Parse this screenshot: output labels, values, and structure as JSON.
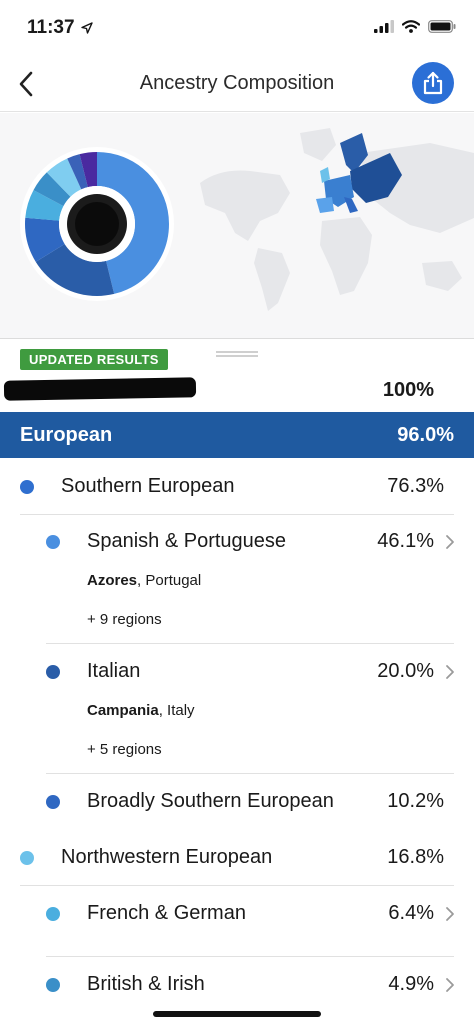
{
  "status": {
    "time": "11:37"
  },
  "nav": {
    "title": "Ancestry Composition"
  },
  "sheet": {
    "badge": "UPDATED RESULTS",
    "total_pct": "100%",
    "band": {
      "label": "European",
      "pct": "96.0%"
    },
    "rows": {
      "southern": {
        "name": "Southern European",
        "pct": "76.3%"
      },
      "spanish": {
        "name": "Spanish & Portuguese",
        "pct": "46.1%",
        "region_bold": "Azores",
        "region_rest": ", Portugal",
        "more": "+ 9 regions"
      },
      "italian": {
        "name": "Italian",
        "pct": "20.0%",
        "region_bold": "Campania",
        "region_rest": ", Italy",
        "more": "+ 5 regions"
      },
      "broadly": {
        "name": "Broadly Southern European",
        "pct": "10.2%"
      },
      "northwestern": {
        "name": "Northwestern European",
        "pct": "16.8%"
      },
      "french": {
        "name": "French & German",
        "pct": "6.4%"
      },
      "british": {
        "name": "British & Irish",
        "pct": "4.9%"
      }
    }
  },
  "colors": {
    "band": "#1f5aa0",
    "southern_dot": "#2f6fcf",
    "spanish_dot": "#4a8fe0",
    "italian_dot": "#2a5da8",
    "broadly_dot": "#2f68c2",
    "northwestern_dot": "#6cc1ea",
    "french_dot": "#4aaedf",
    "british_dot": "#3a8fc8",
    "badge": "#3f9b3f"
  }
}
